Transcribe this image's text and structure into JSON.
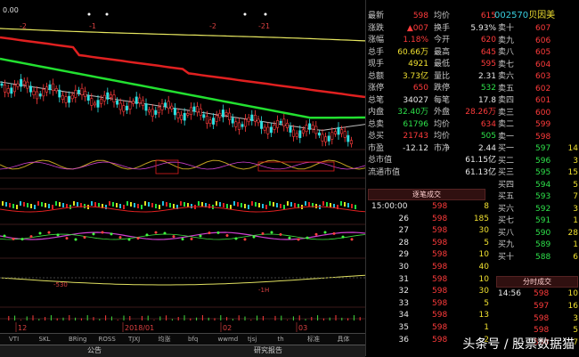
{
  "top_markers": [
    "-2",
    "-1",
    "-2",
    "-21"
  ],
  "price_top": "0.00",
  "vol_labels": [
    "-530",
    "-1H"
  ],
  "date_axis": [
    "12",
    "2018/01",
    "02",
    "03"
  ],
  "tabs": [
    "VTI",
    "SKL",
    "BRing",
    "ROSS",
    "TJXJ",
    "均涨",
    "bfq",
    "wwmd",
    "tjsj",
    "th",
    "标准",
    "具体"
  ],
  "bottom_tabs": [
    "公告",
    "研究报告"
  ],
  "quote": {
    "code": "002570",
    "name": "贝因美",
    "rows": [
      {
        "l1": "最新",
        "v1": "598",
        "c1": "red",
        "l2": "均价",
        "v2": "615",
        "c2": "red"
      },
      {
        "l1": "涨跌",
        "v1": "▲007",
        "c1": "red",
        "l2": "换手",
        "v2": "5.93%",
        "c2": "white"
      },
      {
        "l1": "涨幅",
        "v1": "1.18%",
        "c1": "red",
        "l2": "今开",
        "v2": "620",
        "c2": "red"
      },
      {
        "l1": "总手",
        "v1": "60.66万",
        "c1": "yellow",
        "l2": "最高",
        "v2": "645",
        "c2": "red"
      },
      {
        "l1": "现手",
        "v1": "4921",
        "c1": "yellow",
        "l2": "最低",
        "v2": "595",
        "c2": "red"
      },
      {
        "l1": "总额",
        "v1": "3.73亿",
        "c1": "yellow",
        "l2": "量比",
        "v2": "2.31",
        "c2": "white"
      },
      {
        "l1": "涨停",
        "v1": "650",
        "c1": "red",
        "l2": "跌停",
        "v2": "532",
        "c2": "green"
      },
      {
        "l1": "总笔",
        "v1": "34027",
        "c1": "white",
        "l2": "每笔",
        "v2": "17.8",
        "c2": "white"
      },
      {
        "l1": "内盘",
        "v1": "32.40万",
        "c1": "green",
        "l2": "外盘",
        "v2": "28.26万",
        "c2": "red"
      },
      {
        "l1": "总卖",
        "v1": "61796",
        "c1": "green",
        "l2": "均价",
        "v2": "634",
        "c2": "red"
      },
      {
        "l1": "总买",
        "v1": "21743",
        "c1": "red",
        "l2": "均价",
        "v2": "505",
        "c2": "green"
      },
      {
        "l1": "市盈",
        "v1": "-12.12",
        "c1": "white",
        "l2": "市净",
        "v2": "2.44",
        "c2": "white"
      },
      {
        "l1": "总市值",
        "v1": "",
        "c1": "white",
        "l2": "",
        "v2": "61.15亿",
        "c2": "white"
      },
      {
        "l1": "流通市值",
        "v1": "",
        "c1": "white",
        "l2": "",
        "v2": "61.13亿",
        "c2": "white"
      }
    ]
  },
  "ladder": {
    "sell": [
      {
        "label": "卖十",
        "price": "607",
        "vol": ""
      },
      {
        "label": "卖九",
        "price": "606",
        "vol": ""
      },
      {
        "label": "卖八",
        "price": "605",
        "vol": ""
      },
      {
        "label": "卖七",
        "price": "604",
        "vol": ""
      },
      {
        "label": "卖六",
        "price": "603",
        "vol": ""
      },
      {
        "label": "卖五",
        "price": "602",
        "vol": ""
      },
      {
        "label": "卖四",
        "price": "601",
        "vol": ""
      },
      {
        "label": "卖三",
        "price": "600",
        "vol": ""
      },
      {
        "label": "卖二",
        "price": "599",
        "vol": ""
      },
      {
        "label": "卖一",
        "price": "598",
        "vol": ""
      }
    ],
    "buy": [
      {
        "label": "买一",
        "price": "597",
        "vol": "14"
      },
      {
        "label": "买二",
        "price": "596",
        "vol": "3"
      },
      {
        "label": "买三",
        "price": "595",
        "vol": "15"
      },
      {
        "label": "买四",
        "price": "594",
        "vol": "5"
      },
      {
        "label": "买五",
        "price": "593",
        "vol": "7"
      },
      {
        "label": "买六",
        "price": "592",
        "vol": "3"
      },
      {
        "label": "买七",
        "price": "591",
        "vol": "1"
      },
      {
        "label": "买八",
        "price": "590",
        "vol": "28"
      },
      {
        "label": "买九",
        "price": "589",
        "vol": "1"
      },
      {
        "label": "买十",
        "price": "588",
        "vol": "6"
      }
    ]
  },
  "trade_title": "逐笔成交",
  "trade_title2": "分时成交",
  "trades": [
    {
      "t": "15:00:00",
      "p": "598",
      "v": "8"
    },
    {
      "t": "26",
      "p": "598",
      "v": "185"
    },
    {
      "t": "27",
      "p": "598",
      "v": "30"
    },
    {
      "t": "28",
      "p": "598",
      "v": "5"
    },
    {
      "t": "29",
      "p": "598",
      "v": "10"
    },
    {
      "t": "30",
      "p": "598",
      "v": "40"
    },
    {
      "t": "31",
      "p": "598",
      "v": "10"
    },
    {
      "t": "32",
      "p": "598",
      "v": "30"
    },
    {
      "t": "33",
      "p": "598",
      "v": "5"
    },
    {
      "t": "34",
      "p": "598",
      "v": "13"
    },
    {
      "t": "35",
      "p": "598",
      "v": "1"
    },
    {
      "t": "36",
      "p": "598",
      "v": "2"
    }
  ],
  "minute_trades": [
    {
      "t": "14:56",
      "p": "598",
      "v": "10"
    },
    {
      "t": "",
      "p": "597",
      "v": "16"
    },
    {
      "t": "",
      "p": "598",
      "v": "3"
    },
    {
      "t": "",
      "p": "598",
      "v": "5"
    },
    {
      "t": "",
      "p": "598",
      "v": "7"
    }
  ],
  "watermark": "头条号 / 股票数据猫",
  "colors": {
    "price_up": "#ff3b3b",
    "price_down": "#2ee04a",
    "ma_yellow": "#e8e860",
    "ma_red": "#e02020",
    "ma_green": "#22e030",
    "ma_white": "#bbbbbb"
  }
}
